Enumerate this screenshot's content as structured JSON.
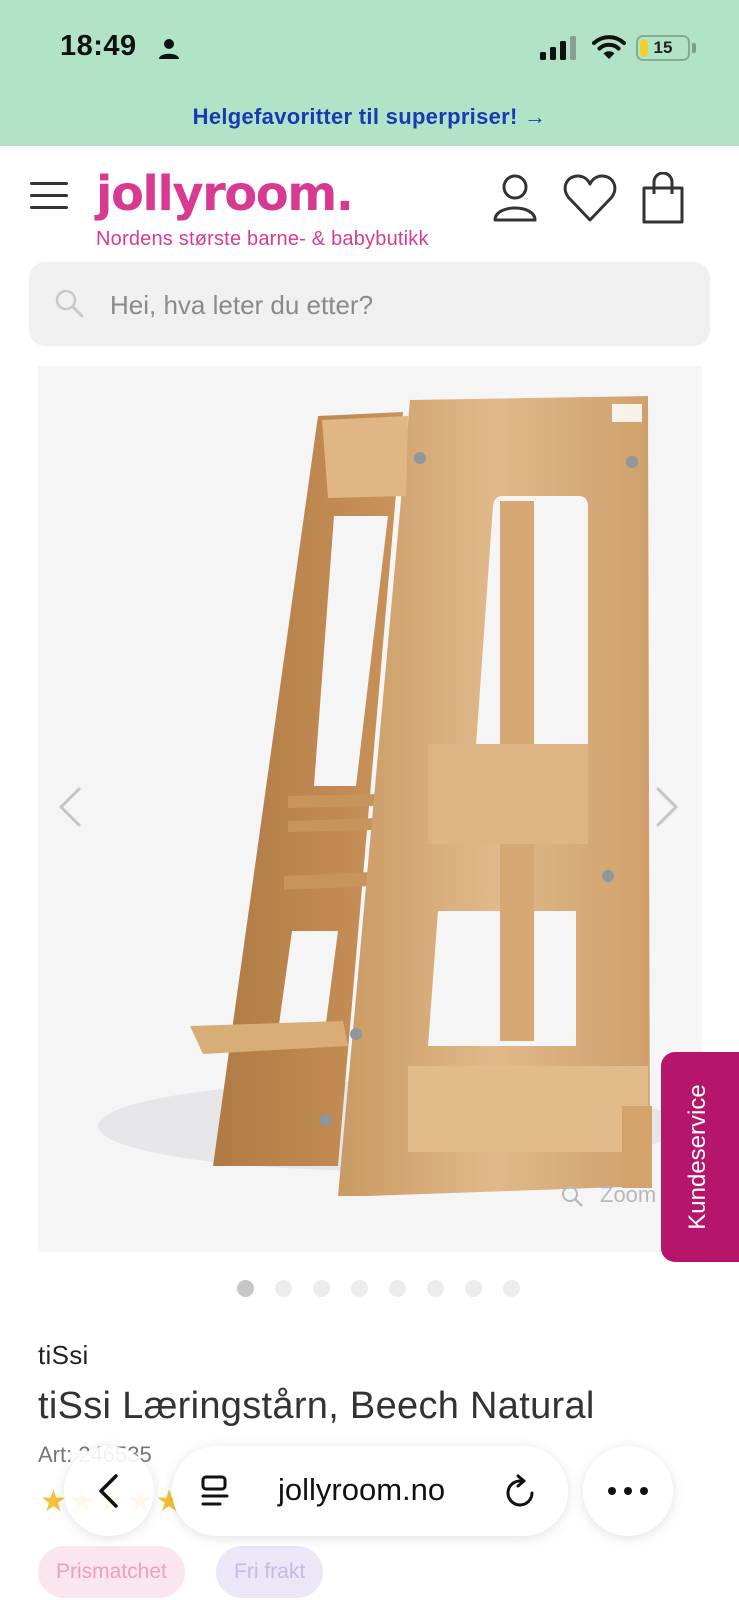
{
  "status_bar": {
    "time": "18:49",
    "battery": "15",
    "battery_level": 0.15,
    "icons": [
      "person-icon",
      "signal-icon",
      "wifi-icon",
      "battery-icon"
    ]
  },
  "promo": {
    "text": "Helgefavoritter til superpriser! →"
  },
  "header": {
    "logo": "jollyroom.",
    "tagline": "Nordens største barne- & babybutikk",
    "icons": [
      "menu-icon",
      "account-icon",
      "wishlist-heart-icon",
      "shopping-bag-icon"
    ]
  },
  "search": {
    "placeholder": "Hei, hva leter du etter?"
  },
  "gallery": {
    "zoom_label": "Zoom",
    "slide_count": 8,
    "active_slide": 1
  },
  "customer_service": {
    "label": "Kundeservice"
  },
  "product": {
    "brand": "tiSsi",
    "title": "tiSsi Læringstårn, Beech Natural",
    "article_no": "Art: 246535",
    "stars": "★★★★★",
    "tags": [
      "Prismatchet",
      "Fri frakt"
    ]
  },
  "browser": {
    "url": "jollyroom.no"
  },
  "colors": {
    "brand_pink": "#d83a92",
    "promo_blue": "#1b38b5",
    "topband_green": "#b1e4c7",
    "kundeservice": "#b5166c"
  }
}
